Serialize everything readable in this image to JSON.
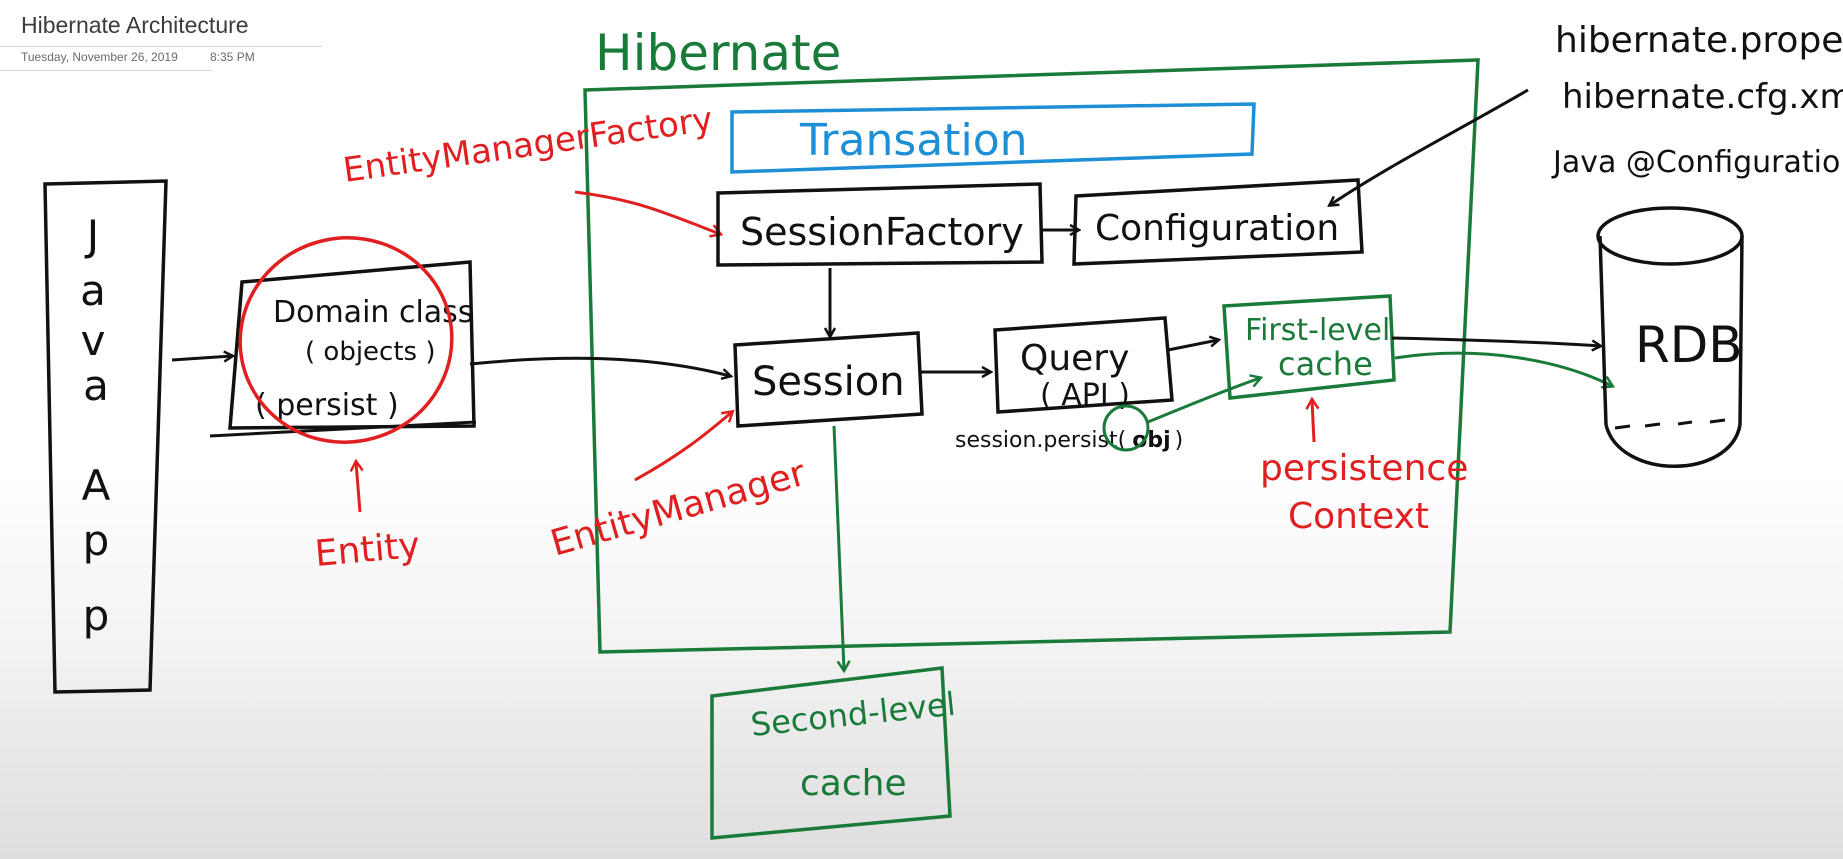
{
  "page": {
    "title": "Hibernate Architecture",
    "date": "Tuesday, November 26, 2019",
    "time": "8:35 PM"
  },
  "colors": {
    "ink": "#111111",
    "red": "#e02020",
    "green": "#1a7a3a",
    "blue": "#1d8fd6"
  },
  "diagram": {
    "hibernate_label": "Hibernate",
    "java_app": [
      "J",
      "a",
      "v",
      "a",
      "A",
      "p",
      "p"
    ],
    "domain_line1": "Domain class",
    "domain_line2": "( objects )",
    "domain_line3": "( persist )",
    "entity": "Entity",
    "entity_manager_factory": "EntityManagerFactory",
    "entity_manager": "EntityManager",
    "transaction": "Transation",
    "session_factory": "SessionFactory",
    "configuration": "Configuration",
    "session": "Session",
    "query_line1": "Query",
    "query_line2": "( API )",
    "session_persist": "session.persist(",
    "obj": "obj",
    "session_persist_end": ")",
    "first_level_line1": "First-level",
    "first_level_line2": "cache",
    "persistence_line1": "persistence",
    "persistence_line2": "Context",
    "second_level_line1": "Second-level",
    "second_level_line2": "cache",
    "rdb": "RDB",
    "config_files": [
      "hibernate.properties",
      "hibernate.cfg.xml",
      "Java @Configuration"
    ]
  }
}
